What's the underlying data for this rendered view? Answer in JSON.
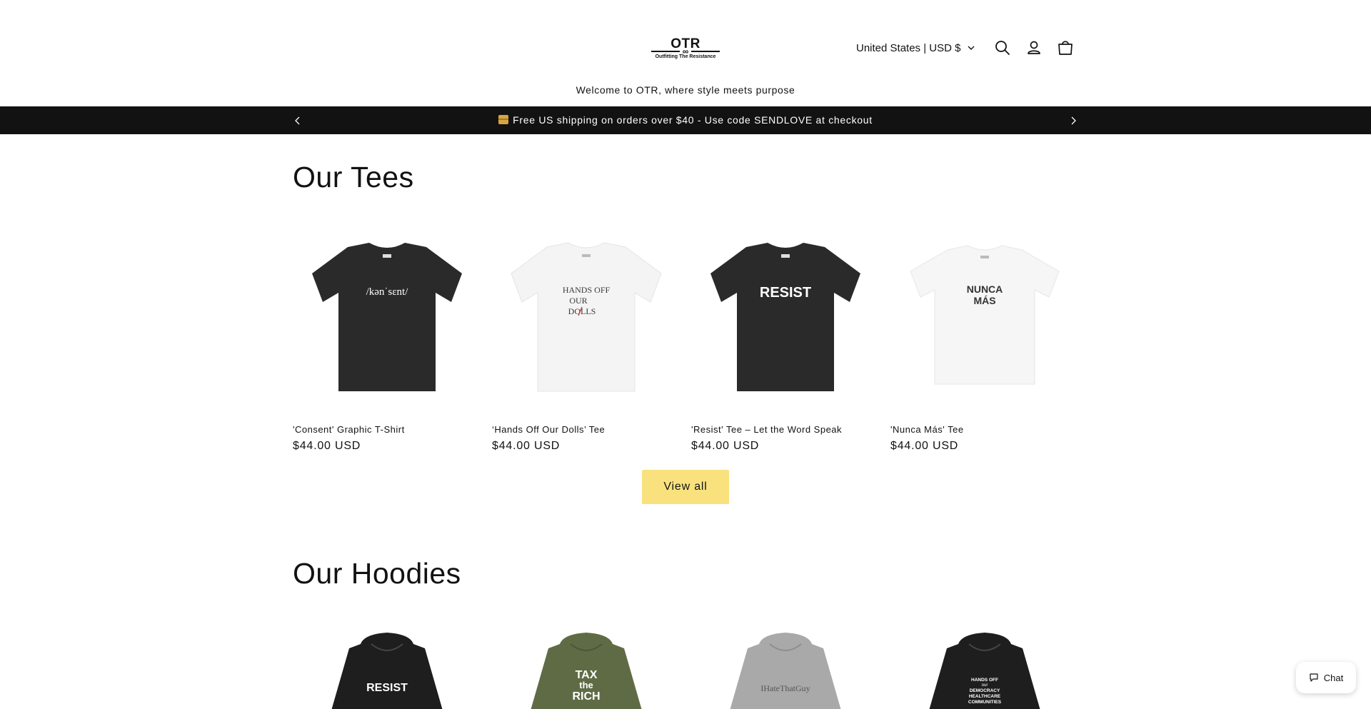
{
  "header": {
    "logo_title": "OTR",
    "logo_subtitle": "Outfitting The Resistance",
    "locale_label": "United States | USD $",
    "icons": [
      "search-icon",
      "account-icon",
      "cart-icon",
      "chevron-down-icon"
    ]
  },
  "welcome_text": "Welcome to OTR, where style meets purpose",
  "announcement": {
    "text": "Free US shipping on orders over $40 - Use code SENDLOVE at checkout",
    "icon": "package-icon"
  },
  "tees": {
    "title": "Our Tees",
    "products": [
      {
        "name": "'Consent' Graphic T-Shirt",
        "price": "$44.00 USD",
        "print": "/kənˈsɛnt/",
        "shirt_color": "#2a2a2a",
        "print_color": "#ffffff"
      },
      {
        "name": "‘Hands Off Our Dolls’ Tee",
        "price": "$44.00 USD",
        "print_lines": [
          "HANDS OFF",
          "OUR",
          "DOLLS"
        ],
        "shirt_color": "#f4f4f4",
        "print_color": "#3a3a3a",
        "accent_color": "#c0392b"
      },
      {
        "name": "'Resist' Tee – Let the Word Speak",
        "price": "$44.00 USD",
        "print": "RESIST",
        "shirt_color": "#2a2a2a",
        "print_color": "#ffffff"
      },
      {
        "name": "'Nunca Más' Tee",
        "price": "$44.00 USD",
        "print_lines": [
          "NUNCA",
          "MÁS"
        ],
        "shirt_color": "#f4f4f4",
        "print_color": "#333333"
      }
    ],
    "view_all_label": "View all"
  },
  "hoodies": {
    "title": "Our Hoodies",
    "products": [
      {
        "print": "RESIST",
        "hoodie_color": "#1e1e1e",
        "print_color": "#ffffff"
      },
      {
        "print_lines": [
          "TAX",
          "the",
          "RICH"
        ],
        "hoodie_color": "#5f6b45",
        "print_color": "#ffffff"
      },
      {
        "print": "IHateThatGuy",
        "hoodie_color": "#a9a9a9",
        "print_color": "#555555"
      },
      {
        "print_lines": [
          "HANDS OFF",
          "our",
          "DEMOCRACY",
          "HEALTHCARE",
          "COMMUNITIES"
        ],
        "hoodie_color": "#1e1e1e",
        "print_color": "#ffffff"
      }
    ]
  },
  "chat": {
    "label": "Chat",
    "icon": "chat-bubble-icon"
  },
  "colors": {
    "announcement_bg": "#121212",
    "button_bg": "#f9e27d",
    "text": "#121212"
  }
}
